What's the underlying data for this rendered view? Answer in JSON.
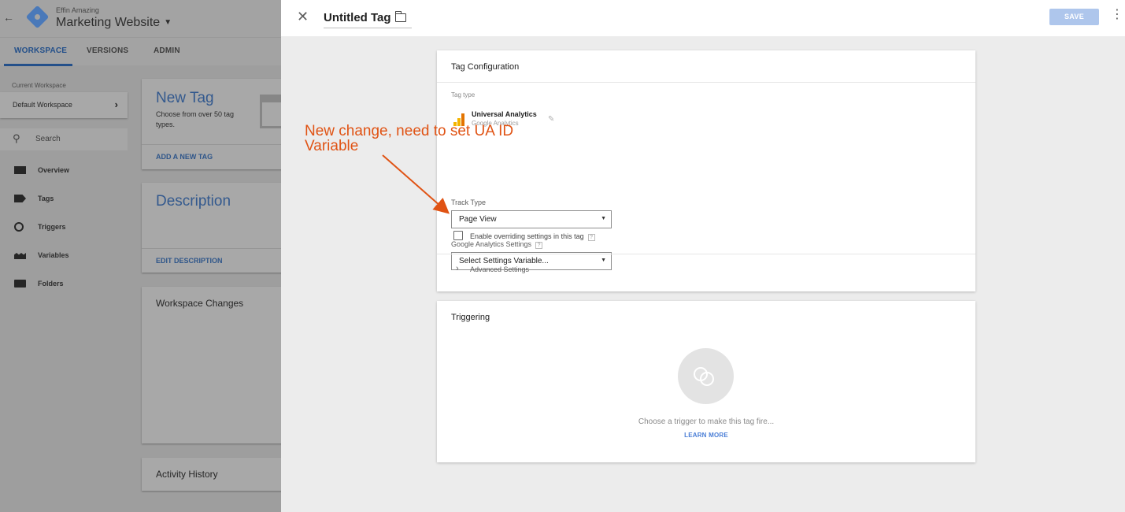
{
  "app": {
    "account_name": "Effin Amazing",
    "container_name": "Marketing Website",
    "tabs": [
      "WORKSPACE",
      "VERSIONS",
      "ADMIN"
    ],
    "current_workspace_label": "Current Workspace",
    "workspace_name": "Default Workspace",
    "search_placeholder": "Search",
    "nav": [
      "Overview",
      "Tags",
      "Triggers",
      "Variables",
      "Folders"
    ],
    "cards": {
      "new_tag_title": "New Tag",
      "new_tag_desc": "Choose from over 50 tag types.",
      "new_tag_link": "ADD A NEW TAG",
      "description_title": "Description",
      "description_link": "EDIT DESCRIPTION",
      "workspace_changes": "Workspace Changes",
      "activity_history": "Activity History"
    }
  },
  "editor": {
    "title": "Untitled Tag",
    "save_label": "SAVE",
    "tag_config": {
      "title": "Tag Configuration",
      "tag_type_label": "Tag type",
      "tag_type_name": "Universal Analytics",
      "tag_type_vendor": "Google Analytics",
      "track_type_label": "Track Type",
      "track_type_value": "Page View",
      "ga_settings_label": "Google Analytics Settings",
      "ga_settings_value": "Select Settings Variable...",
      "override_label": "Enable overriding settings in this tag",
      "override_checked": false,
      "advanced_label": "Advanced Settings",
      "help_glyph": "?"
    },
    "triggering": {
      "title": "Triggering",
      "message": "Choose a trigger to make this tag fire...",
      "learn_more": "LEARN MORE"
    }
  },
  "annotation": {
    "line1": "New change, need to set UA ID",
    "line2": "Variable",
    "color": "#e05314"
  },
  "colors": {
    "accent_blue": "#4a7ed6",
    "save_button_disabled": "#aec6ec",
    "ua_yellow": "#f4b400",
    "ua_orange": "#e37400"
  }
}
